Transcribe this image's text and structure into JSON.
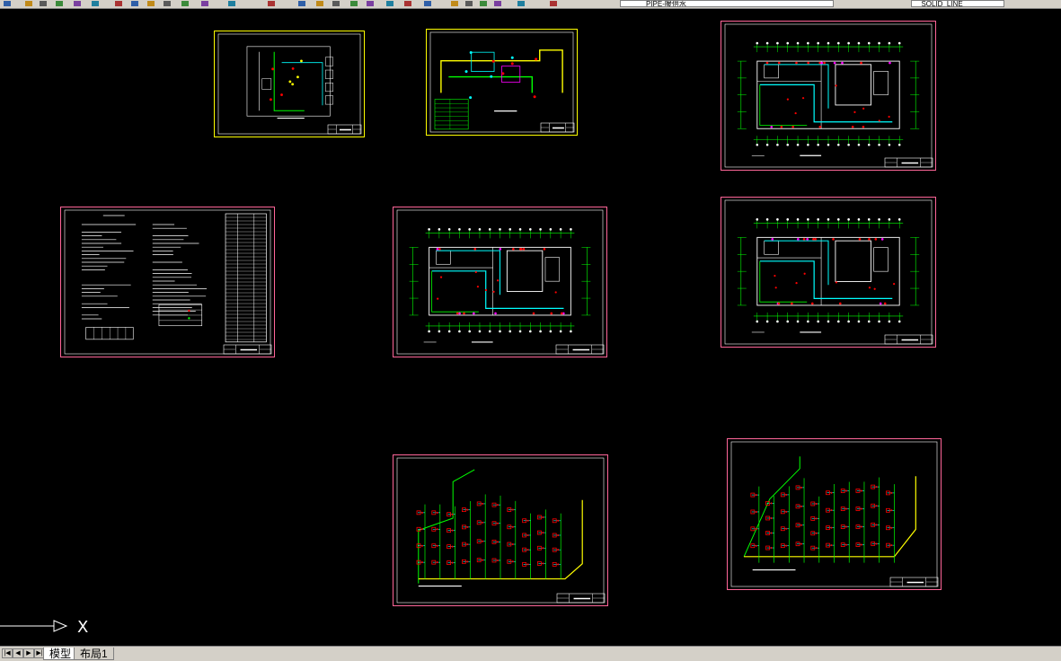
{
  "toolbar": {
    "layer_name": "PIPE-暖供水",
    "style_name": "_SOLID_LINE",
    "tools": [
      "new-icon",
      "open-icon",
      "save-icon",
      "print-icon",
      "plot-preview-icon",
      "publish-icon",
      "cut-icon",
      "copy-icon",
      "paste-icon",
      "match-properties-icon",
      "undo-icon",
      "redo-icon",
      "pan-icon",
      "zoom-realtime-icon",
      "zoom-window-icon",
      "zoom-previous-icon",
      "properties-icon",
      "design-center-icon",
      "tool-palettes-icon",
      "sheet-set-icon",
      "markup-icon",
      "calculator-icon",
      "help-icon",
      "layer-manager-icon",
      "layer-state-icon",
      "layer-previous-icon",
      "line-weight-icon",
      "plot-style-icon"
    ]
  },
  "layout_tabs": {
    "nav_buttons": [
      "first-tab-icon",
      "prev-tab-icon",
      "next-tab-icon",
      "last-tab-icon"
    ],
    "tabs": [
      {
        "label": "模型",
        "active": true
      },
      {
        "label": "布局1",
        "active": false
      }
    ]
  },
  "ucs": {
    "x_label": "X"
  },
  "sheets": [
    {
      "id": "system-schematic-1",
      "kind": "schematic",
      "border": "#ffff00"
    },
    {
      "id": "system-schematic-2",
      "kind": "schematic-table",
      "border": "#ffff00"
    },
    {
      "id": "floor-plan-1",
      "kind": "plan",
      "border": "#ff6699"
    },
    {
      "id": "design-notes",
      "kind": "notes",
      "border": "#ff6699"
    },
    {
      "id": "floor-plan-2",
      "kind": "plan",
      "border": "#ff6699"
    },
    {
      "id": "floor-plan-3",
      "kind": "plan",
      "border": "#ff6699"
    },
    {
      "id": "isometric-1",
      "kind": "isometric",
      "border": "#ff6699"
    },
    {
      "id": "isometric-2",
      "kind": "isometric",
      "border": "#ff6699"
    }
  ],
  "colors": {
    "background": "#000000",
    "pink_border": "#ff6699",
    "yellow_border": "#ffff00",
    "white_line": "#ffffff",
    "cyan_line": "#00ffff",
    "green_line": "#00ff00",
    "red_mark": "#ff0000",
    "magenta_mark": "#ff00ff"
  }
}
